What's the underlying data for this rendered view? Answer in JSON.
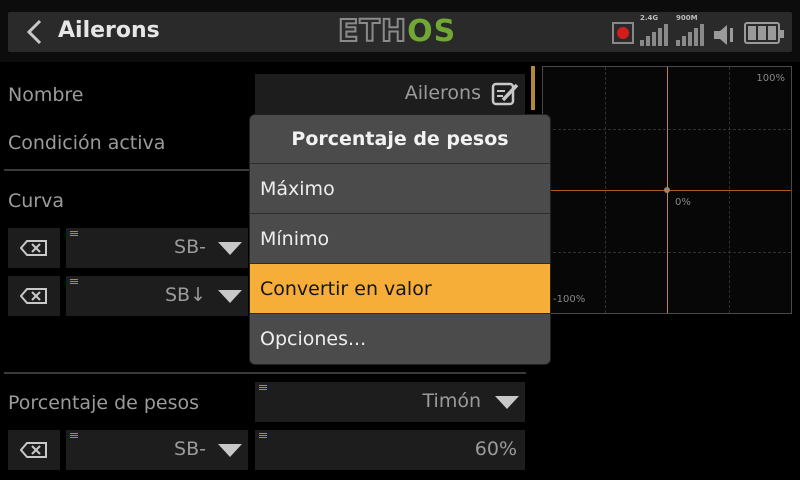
{
  "header": {
    "title": "Ailerons",
    "logo_main": "ETH",
    "logo_accent": "OS",
    "signal_24": "2.4G",
    "signal_900": "900M"
  },
  "form": {
    "name_label": "Nombre",
    "name_value": "Ailerons",
    "condition_label": "Condición activa",
    "curve_label": "Curva",
    "curve_rows": [
      {
        "switch": "SB-"
      },
      {
        "switch": "SB↓"
      }
    ],
    "weight_label": "Porcentaje de pesos",
    "weight_source": "Timón",
    "weight_row": {
      "switch": "SB-",
      "value": "60%"
    }
  },
  "graph": {
    "top_label": "100%",
    "center_label": "0%",
    "bottom_label": "-100%"
  },
  "popup": {
    "title": "Porcentaje de pesos",
    "items": [
      {
        "label": "Máximo",
        "selected": false
      },
      {
        "label": "Mínimo",
        "selected": false
      },
      {
        "label": "Convertir en valor",
        "selected": true
      },
      {
        "label": "Opciones...",
        "selected": false
      }
    ]
  },
  "colors": {
    "accent": "#f7ae39",
    "logo_green": "#6fa832",
    "record_red": "#d21d1d"
  },
  "icons": [
    "back-arrow-icon",
    "record-icon",
    "signal-2g4-icon",
    "signal-900m-icon",
    "volume-icon",
    "battery-icon",
    "edit-icon",
    "delete-icon",
    "dropdown-chevron-icon"
  ]
}
